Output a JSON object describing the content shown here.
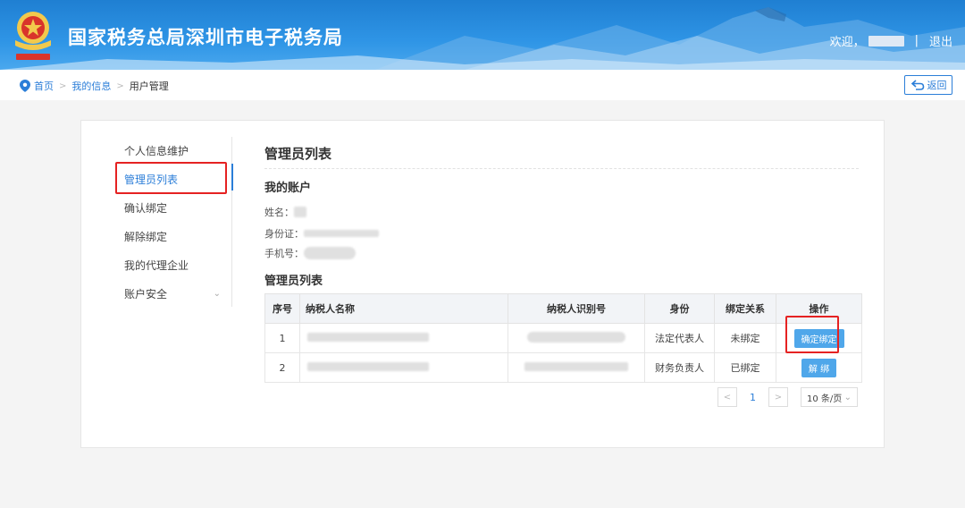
{
  "header": {
    "title": "国家税务总局深圳市电子税务局",
    "welcome": "欢迎，",
    "separator": "|",
    "logout": "退出"
  },
  "breadcrumb": {
    "items": [
      "首页",
      "我的信息",
      "用户管理"
    ],
    "back": "返回"
  },
  "sidebar": {
    "items": [
      {
        "label": "个人信息维护"
      },
      {
        "label": "管理员列表"
      },
      {
        "label": "确认绑定"
      },
      {
        "label": "解除绑定"
      },
      {
        "label": "我的代理企业"
      },
      {
        "label": "账户安全"
      }
    ]
  },
  "main": {
    "title": "管理员列表",
    "account_section": "我的账户",
    "fields": {
      "name": "姓名：",
      "id": "身份证：",
      "phone": "手机号："
    },
    "list_section": "管理员列表",
    "table": {
      "headers": [
        "序号",
        "纳税人名称",
        "纳税人识别号",
        "身份",
        "绑定关系",
        "操作"
      ],
      "rows": [
        {
          "no": "1",
          "role": "法定代表人",
          "status": "未绑定",
          "action": "确定绑定"
        },
        {
          "no": "2",
          "role": "财务负责人",
          "status": "已绑定",
          "action": "解 绑"
        }
      ]
    },
    "pager": {
      "prev": "<",
      "page": "1",
      "next": ">",
      "size": "10 条/页"
    }
  },
  "colors": {
    "accent": "#2b7ed8",
    "button": "#4fa7ea",
    "highlight": "#e52222"
  }
}
